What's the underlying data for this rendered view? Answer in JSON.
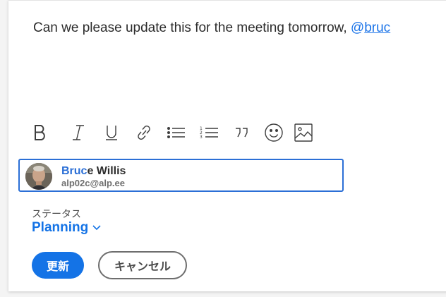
{
  "editor": {
    "text": "Can we please update this for the meeting tomorrow, ",
    "mention_at": "@",
    "mention_query": "bruc"
  },
  "toolbar": {
    "icons": [
      "bold-icon",
      "italic-icon",
      "underline-icon",
      "link-icon",
      "bullet-list-icon",
      "numbered-list-icon",
      "quote-icon",
      "emoji-icon",
      "image-icon"
    ]
  },
  "suggestion": {
    "name_match": "Bruc",
    "name_rest": "e Willis",
    "email": "alp02c@alp.ee"
  },
  "status": {
    "label": "ステータス",
    "value": "Planning"
  },
  "actions": {
    "update_label": "更新",
    "cancel_label": "キャンセル"
  },
  "colors": {
    "accent": "#1473e6",
    "focus_border": "#2b6fd6"
  }
}
